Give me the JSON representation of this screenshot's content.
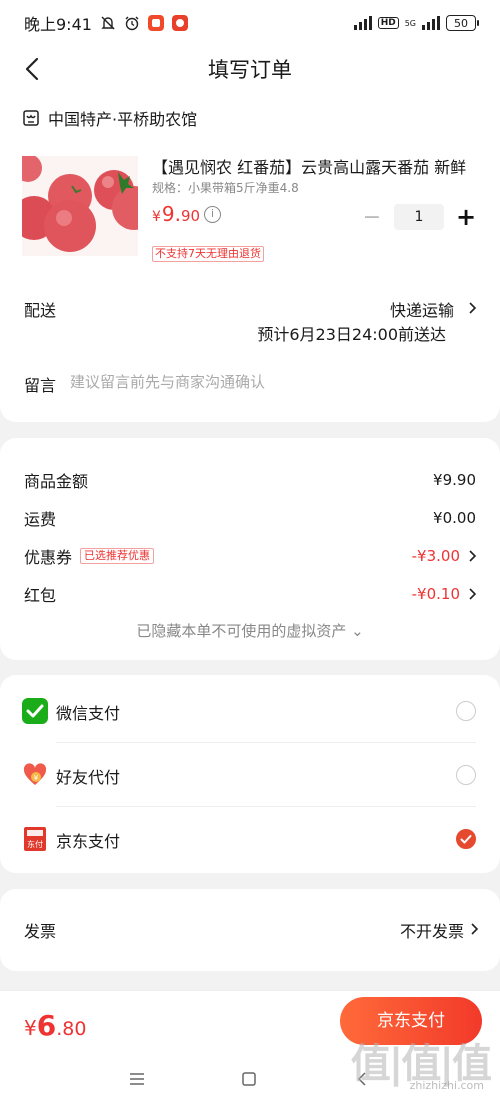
{
  "statusbar": {
    "time": "晚上9:41",
    "signal2_label": "5G",
    "hd_label": "HD",
    "battery": "50"
  },
  "header": {
    "title": "填写订单"
  },
  "shop": {
    "name": "中国特产·平桥助农馆"
  },
  "product": {
    "title": "【遇见悯农 红番茄】云贵高山露天番茄 新鲜",
    "spec": "规格：小果带箱5斤净重4.8",
    "price_currency": "¥",
    "price_int": "9.",
    "price_dec": "90",
    "quantity": "1",
    "no_return_tag": "不支持7天无理由退货",
    "minus": "−",
    "plus": "+",
    "info": "i"
  },
  "delivery": {
    "label": "配送",
    "method": "快递运输",
    "eta": "预计6月23日24:00前送达"
  },
  "message": {
    "label": "留言",
    "placeholder": "建议留言前先与商家沟通确认"
  },
  "summary": {
    "goods_label": "商品金额",
    "goods_value": "¥9.90",
    "shipping_label": "运费",
    "shipping_value": "¥0.00",
    "coupon_label": "优惠券",
    "coupon_tag": "已选推荐优惠",
    "coupon_value": "-¥3.00",
    "redpacket_label": "红包",
    "redpacket_value": "-¥0.10",
    "hidden_note": "已隐藏本单不可使用的虚拟资产 ⌄"
  },
  "payment": {
    "methods": [
      {
        "name": "微信支付",
        "selected": false
      },
      {
        "name": "好友代付",
        "selected": false
      },
      {
        "name": "京东支付",
        "selected": true
      }
    ],
    "brand_color": "#e54a2e"
  },
  "invoice": {
    "label": "发票",
    "value": "不开发票"
  },
  "footer": {
    "currency": "¥",
    "total_int": "6",
    "total_dec": ".80",
    "pay_button": "京东支付"
  },
  "watermark": {
    "main": "值|值|值",
    "sub": "zhizhizhi.com"
  }
}
